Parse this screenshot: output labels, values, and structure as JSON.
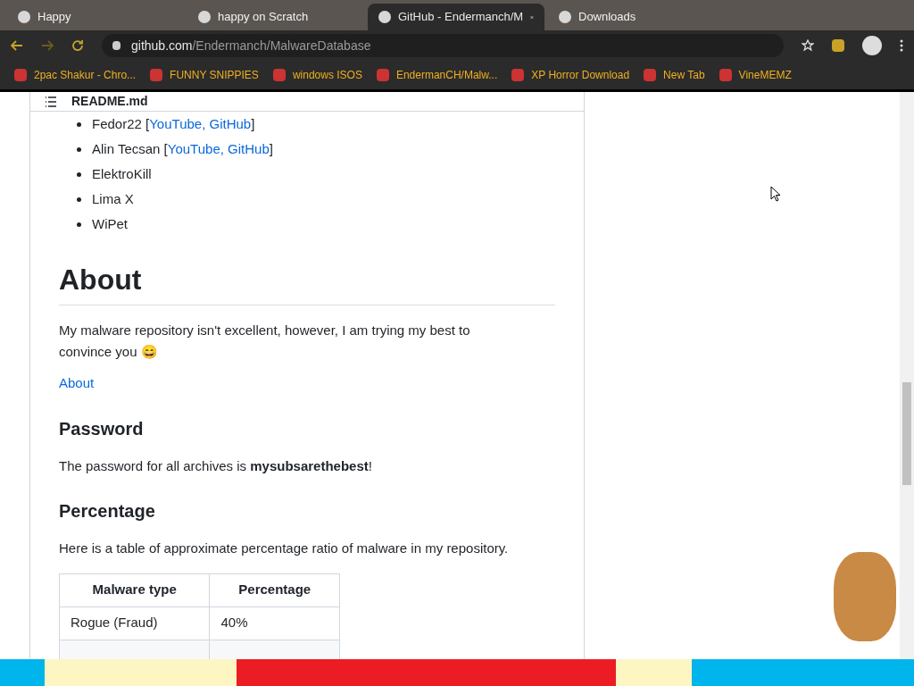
{
  "tabs": [
    {
      "title": "Happy",
      "selected": false
    },
    {
      "title": "happy on Scratch",
      "selected": false
    },
    {
      "title": "GitHub - Endermanch/M",
      "selected": true
    },
    {
      "title": "Downloads",
      "selected": false
    }
  ],
  "address": {
    "domain": "github.com",
    "path": "/Endermanch/MalwareDatabase"
  },
  "bookmarks": [
    {
      "label": "2pac Shakur - Chro..."
    },
    {
      "label": "FUNNY SNIPPIES"
    },
    {
      "label": "windows ISOS"
    },
    {
      "label": "EndermanCH/Malw..."
    },
    {
      "label": "XP Horror Download"
    },
    {
      "label": "New Tab"
    },
    {
      "label": "VineMEMZ"
    }
  ],
  "readme": {
    "filename": "README.md",
    "list": [
      {
        "name": "Fedor22 [",
        "links": "YouTube, GitHub",
        "close": "]"
      },
      {
        "name": "Alin Tecsan [",
        "links": "YouTube, GitHub",
        "close": "]"
      },
      {
        "name": "ElektroKill"
      },
      {
        "name": "Lima X"
      },
      {
        "name": "WiPet"
      }
    ],
    "about_heading": "About",
    "about_text": "My malware repository isn't excellent, however, I am trying my best to convince you 😄",
    "about_image_alt": "About",
    "password_heading": "Password",
    "password_text": "The password for all archives is **mysubsarethebest**!",
    "percentage_heading": "Percentage",
    "percentage_text": "Here is a table of approximate percentage ratio of malware in my repository.",
    "table": {
      "columns": [
        "Malware type",
        "Percentage"
      ],
      "rows": [
        [
          "Rogue (Fraud)",
          "40%"
        ]
      ]
    }
  }
}
